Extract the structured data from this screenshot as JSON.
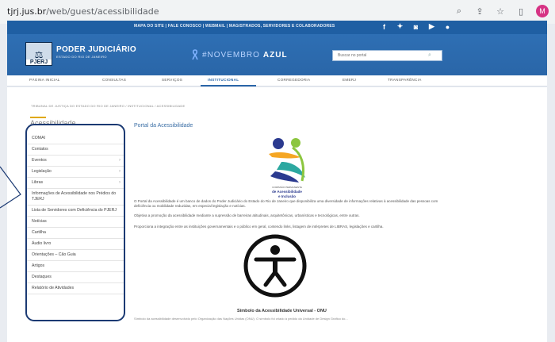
{
  "browser": {
    "url_host": "tjrj.jus.br",
    "url_path": "/web/guest/acessibilidade",
    "avatar_letter": "M"
  },
  "util_bar": {
    "links": "MAPA DO SITE  |  FALE CONOSCO  |  WEBMAIL  |  MAGISTRADOS, SERVIDORES E COLABORADORES"
  },
  "header": {
    "logo_text": "PJERJ",
    "brand_title": "PODER JUDICIÁRIO",
    "brand_subtitle": "ESTADO DO RIO DE JANEIRO",
    "campaign_prefix": "#NOVEMBRO",
    "campaign_suffix": "AZUL",
    "search_placeholder": "Buscar no portal"
  },
  "nav": {
    "items": [
      "PÁGINA INICIAL",
      "CONSULTAS",
      "SERVIÇOS",
      "INSTITUCIONAL",
      "CORREGEDORIA",
      "EMERJ",
      "TRANSPARÊNCIA"
    ],
    "active": "INSTITUCIONAL"
  },
  "breadcrumb": "TRIBUNAL DE JUSTIÇA DO ESTADO DO RIO DE JANEIRO  /  INSTITUCIONAL  /  ACESSIBILIDADE",
  "sidebar": {
    "title": "Acessibilidade",
    "items": [
      {
        "label": "COMAI",
        "arrow": false
      },
      {
        "label": "Contatos",
        "arrow": false
      },
      {
        "label": "Eventos",
        "arrow": true
      },
      {
        "label": "Legislação",
        "arrow": true
      },
      {
        "label": "Libras",
        "arrow": true
      },
      {
        "label": "Informações de Acessibilidade nos Prédios do TJERJ",
        "arrow": false
      },
      {
        "label": "Lista de Servidores com Deficiência do PJERJ",
        "arrow": false
      },
      {
        "label": "Notícias",
        "arrow": false
      },
      {
        "label": "Cartilha",
        "arrow": false
      },
      {
        "label": "Áudio livro",
        "arrow": false
      },
      {
        "label": "Orientações – Cão Guia",
        "arrow": false
      },
      {
        "label": "Artigos",
        "arrow": false
      },
      {
        "label": "Destaques",
        "arrow": false
      },
      {
        "label": "Relatório de Atividades",
        "arrow": false
      }
    ]
  },
  "content": {
    "title": "Portal da Acessibilidade",
    "logo_caption_small": "COMISSÃO PERMANENTE",
    "logo_caption_main": "de Acessibilidade",
    "logo_caption_main2": "e Inclusão",
    "paragraphs": [
      "O Portal da Acessibilidade é um banco de dados do Poder Judiciário do Estado do Rio de Janeiro que disponibiliza uma diversidade de informações relativas à acessibilidade das pessoas com deficiência ou mobilidade reduzidas, em especial legislação e notícias.",
      "Objetiva a promoção da acessibilidade mediante a supressão de barreiras atitudinais, arquitetônicas, urbanísticas e tecnológicas, entre outras.",
      "Proporciona a integração entre as instituições governamentais e o público em geral, contendo links, listagem de intérpretes de LIBRAS, legislações e cartilha."
    ],
    "symbol_title": "Símbolo da Acessibilidade Universal - ONU",
    "symbol_text": "Símbolo da acessibilidade desenvolvido pelo Organização das Nações Unidas (ONU). O símbolo foi criado à pedido da Unidade de Design Gráfico do..."
  },
  "colors": {
    "primary": "#2a66a8",
    "sidebar_frame": "#1b3a73",
    "accent": "#e0a800"
  }
}
